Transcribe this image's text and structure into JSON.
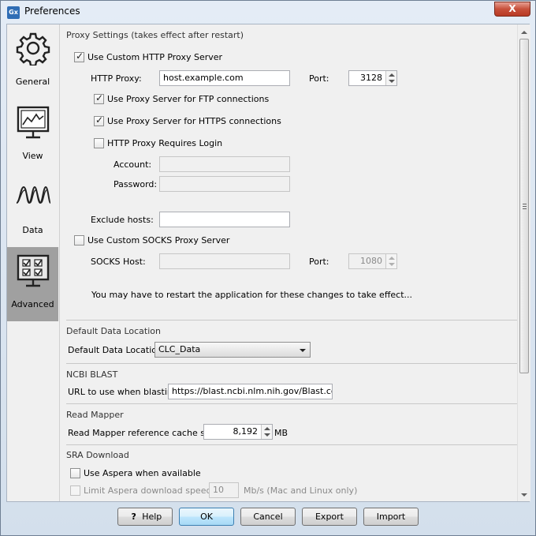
{
  "window": {
    "title": "Preferences",
    "app_icon_text": "Gx",
    "close_symbol": "X"
  },
  "nav": {
    "items": [
      {
        "label": "General",
        "icon": "gear-icon"
      },
      {
        "label": "View",
        "icon": "monitor-chart-icon"
      },
      {
        "label": "Data",
        "icon": "waveform-icon"
      },
      {
        "label": "Advanced",
        "icon": "checklist-icon",
        "selected": true
      }
    ]
  },
  "proxy": {
    "section_title": "Proxy Settings (takes effect after restart)",
    "use_http_label": "Use Custom HTTP Proxy Server",
    "use_http_checked": true,
    "http_proxy_label": "HTTP Proxy:",
    "http_proxy_value": "host.example.com",
    "port_label": "Port:",
    "port_value": "3128",
    "ftp_label": "Use Proxy Server for FTP connections",
    "ftp_checked": true,
    "https_label": "Use Proxy Server for HTTPS connections",
    "https_checked": true,
    "requires_login_label": "HTTP Proxy Requires Login",
    "requires_login_checked": false,
    "account_label": "Account:",
    "account_value": "",
    "password_label": "Password:",
    "password_value": "",
    "exclude_label": "Exclude hosts:",
    "exclude_value": "",
    "use_socks_label": "Use Custom SOCKS Proxy Server",
    "use_socks_checked": false,
    "socks_host_label": "SOCKS Host:",
    "socks_host_value": "",
    "socks_port_label": "Port:",
    "socks_port_value": "1080",
    "restart_note": "You may have to restart the application for these changes to take effect..."
  },
  "data_location": {
    "section_title": "Default Data Location",
    "label": "Default Data Location:",
    "selected": "CLC_Data"
  },
  "blast": {
    "section_title": "NCBI BLAST",
    "url_label": "URL to use when blasting:",
    "url_value": "https://blast.ncbi.nlm.nih.gov/Blast.cgi"
  },
  "read_mapper": {
    "section_title": "Read Mapper",
    "cache_label": "Read Mapper reference cache size:",
    "cache_value": "8,192",
    "cache_unit": "MB"
  },
  "sra": {
    "section_title": "SRA Download",
    "aspera_label": "Use Aspera when available",
    "aspera_checked": false,
    "limit_label": "Limit Aspera download speeds to",
    "limit_value": "10",
    "limit_unit": "Mb/s (Mac and Linux only)"
  },
  "buttons": {
    "help_glyph": "?",
    "help": "Help",
    "ok": "OK",
    "cancel": "Cancel",
    "export": "Export",
    "import": "Import"
  },
  "colors": {
    "selected_nav": "#a0a0a0",
    "default_button": "#a7d9f5",
    "close_button": "#c7503a"
  }
}
